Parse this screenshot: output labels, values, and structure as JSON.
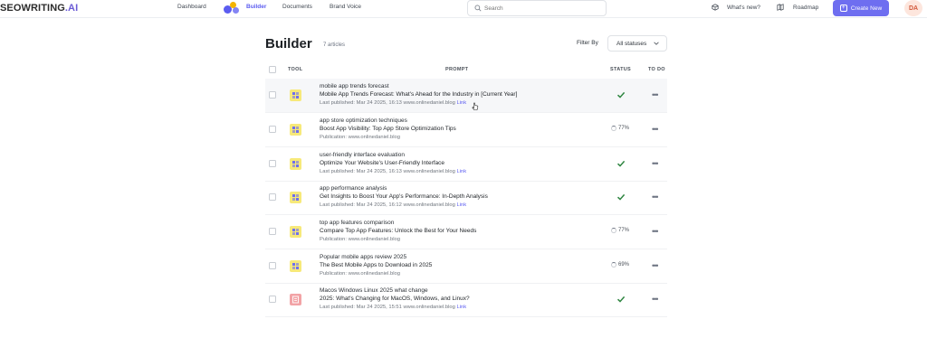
{
  "brand": {
    "logo_main": "SEOWRITING",
    "logo_suffix": ".AI"
  },
  "nav": {
    "dashboard": "Dashboard",
    "builder": "Builder",
    "documents": "Documents",
    "brand_voice": "Brand Voice"
  },
  "search": {
    "placeholder": "Search"
  },
  "right_nav": {
    "whats_new": "What's new?",
    "roadmap": "Roadmap"
  },
  "create_new": {
    "label": "Create New"
  },
  "avatar": {
    "initials": "DA"
  },
  "page": {
    "title": "Builder",
    "article_count": "7 articles"
  },
  "filter": {
    "label": "Filter By",
    "selected": "All statuses"
  },
  "columns": {
    "tool": "TOOL",
    "prompt": "PROMPT",
    "status": "STATUS",
    "todo": "TO DO"
  },
  "rows": [
    {
      "keyword": "mobile app trends forecast",
      "title": "Mobile App Trends Forecast: What's Ahead for the Industry in [Current Year]",
      "meta": "Last published: Mar 24 2025, 16:13 www.onlinedaniel.blog ",
      "link": "Link",
      "status": "done",
      "percent": "",
      "tool_color": "yellow"
    },
    {
      "keyword": "app store optimization techniques",
      "title": "Boost App Visibility: Top App Store Optimization Tips",
      "meta": "Publication: www.onlinedaniel.blog",
      "link": "",
      "status": "progress",
      "percent": "77%",
      "tool_color": "yellow"
    },
    {
      "keyword": "user-friendly interface evaluation",
      "title": "Optimize Your Website's User-Friendly Interface",
      "meta": "Last published: Mar 24 2025, 16:13 www.onlinedaniel.blog ",
      "link": "Link",
      "status": "done",
      "percent": "",
      "tool_color": "yellow"
    },
    {
      "keyword": "app performance analysis",
      "title": "Get Insights to Boost Your App's Performance: In-Depth Analysis",
      "meta": "Last published: Mar 24 2025, 16:12 www.onlinedaniel.blog ",
      "link": "Link",
      "status": "done",
      "percent": "",
      "tool_color": "yellow"
    },
    {
      "keyword": "top app features comparison",
      "title": "Compare Top App Features: Unlock the Best for Your Needs",
      "meta": "Publication: www.onlinedaniel.blog",
      "link": "",
      "status": "progress",
      "percent": "77%",
      "tool_color": "yellow"
    },
    {
      "keyword": "Popular mobile apps review 2025",
      "title": "The Best Mobile Apps to Download in 2025",
      "meta": "Publication: www.onlinedaniel.blog",
      "link": "",
      "status": "progress",
      "percent": "69%",
      "tool_color": "yellow"
    },
    {
      "keyword": "Macos Windows Linux 2025 what change",
      "title": "2025: What's Changing for MacOS, Windows, and Linux?",
      "meta": "Last published: Mar 24 2025, 15:51 www.onlinedaniel.blog ",
      "link": "Link",
      "status": "done",
      "percent": "",
      "tool_color": "red"
    }
  ],
  "colors": {
    "accent": "#6e6ef0",
    "check": "#2e8540",
    "link": "#5b5cf0"
  }
}
